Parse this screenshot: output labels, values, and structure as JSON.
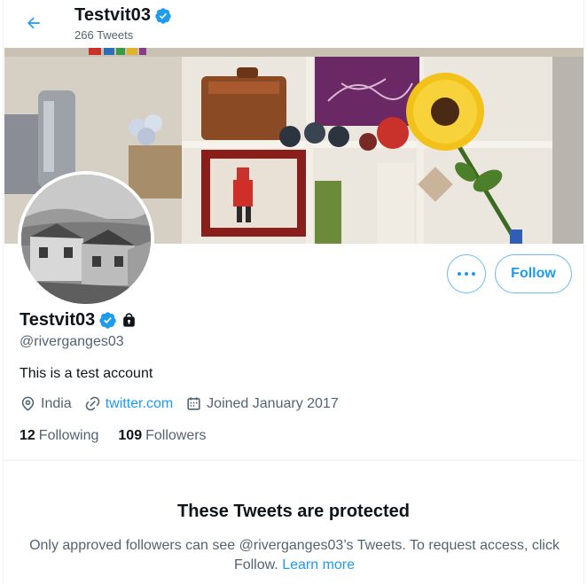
{
  "header": {
    "back_icon": "arrow-left-icon",
    "name": "Testvit03",
    "tweet_count": "266 Tweets"
  },
  "profile": {
    "name": "Testvit03",
    "verified_icon": "verified-badge-icon",
    "protected_icon": "lock-icon",
    "handle": "@riverganges03",
    "bio": "This is a test account",
    "location": "India",
    "website": "twitter.com",
    "joined": "Joined January 2017",
    "following_count": "12",
    "following_label": "Following",
    "followers_count": "109",
    "followers_label": "Followers"
  },
  "actions": {
    "more_icon": "more-dots-icon",
    "follow_label": "Follow"
  },
  "protected": {
    "title": "These Tweets are protected",
    "message": "Only approved followers can see @riverganges03’s Tweets. To request access, click Follow.",
    "learn_more": "Learn more"
  },
  "colors": {
    "accent": "#1d9bf0",
    "text_primary": "#0f1419",
    "text_secondary": "#536471"
  }
}
